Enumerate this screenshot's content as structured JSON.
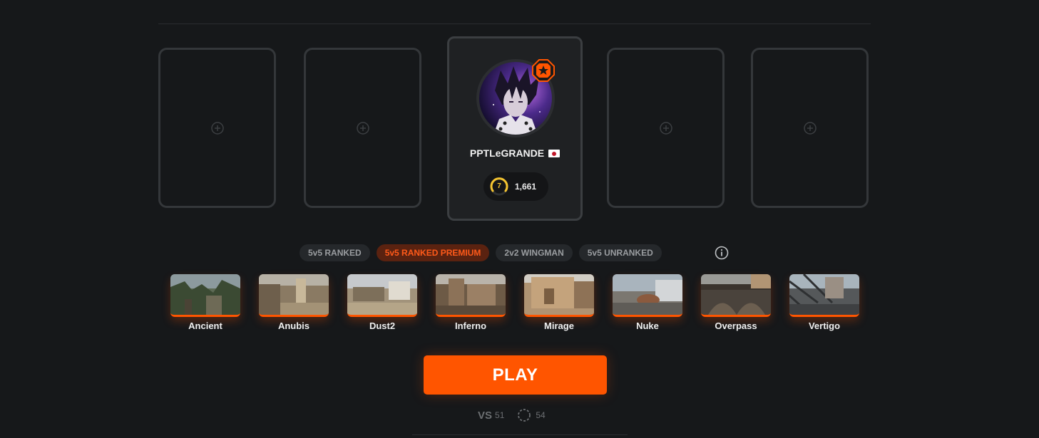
{
  "lobby": {
    "empty_slots": [
      {
        "icon": "plus-circle-icon"
      },
      {
        "icon": "plus-circle-icon"
      },
      {
        "icon": "plus-circle-icon"
      },
      {
        "icon": "plus-circle-icon"
      }
    ],
    "player": {
      "nickname": "PPTLeGRANDE",
      "country_flag": "japan-flag-icon",
      "skill_level": "7",
      "elo": "1,661",
      "badge_icon": "star-octagon-badge-icon"
    }
  },
  "modes": [
    {
      "label": "5v5 RANKED",
      "active": false
    },
    {
      "label": "5v5 RANKED PREMIUM",
      "active": true
    },
    {
      "label": "2v2 WINGMAN",
      "active": false
    },
    {
      "label": "5v5 UNRANKED",
      "active": false
    }
  ],
  "maps": [
    {
      "name": "Ancient"
    },
    {
      "name": "Anubis"
    },
    {
      "name": "Dust2"
    },
    {
      "name": "Inferno"
    },
    {
      "name": "Mirage"
    },
    {
      "name": "Nuke"
    },
    {
      "name": "Overpass"
    },
    {
      "name": "Vertigo"
    }
  ],
  "play_label": "PLAY",
  "queue_stats": {
    "vs_label": "VS",
    "vs_count": "51",
    "searching_count": "54"
  },
  "colors": {
    "accent": "#ff5500",
    "background": "#16181a",
    "card": "#1f2123",
    "level_ring": "#f4c430"
  }
}
